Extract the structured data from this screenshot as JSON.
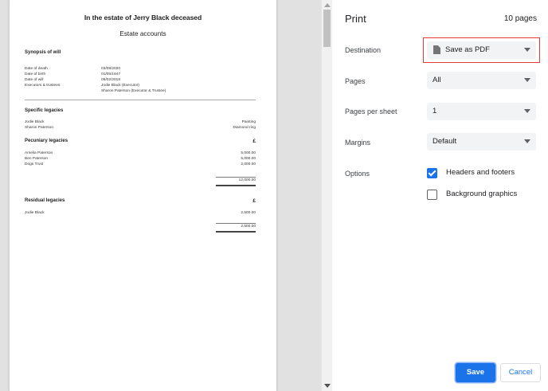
{
  "document": {
    "title": "In the estate of Jerry Black deceased",
    "subtitle": "Estate accounts",
    "synopsis": {
      "heading": "Synopsis of will",
      "rows": [
        {
          "label": "Date of death",
          "value": "03/08/2020"
        },
        {
          "label": "Date of birth",
          "value": "01/05/1947"
        },
        {
          "label": "Date of will",
          "value": "05/02/2018"
        },
        {
          "label": "Executors & trustees",
          "value": "Jodie Black (Executor)"
        },
        {
          "label": "",
          "value": "Sharon Paterson (Executor & Trustee)"
        }
      ]
    },
    "specific_legacies": {
      "heading": "Specific legacies",
      "rows": [
        {
          "label": "Jodie Black",
          "amount": "Painting"
        },
        {
          "label": "Sharon Paterson",
          "amount": "Diamond ring"
        }
      ]
    },
    "pecuniary_legacies": {
      "heading": "Pecuniary legacies",
      "currency": "£",
      "rows": [
        {
          "label": "Amelia Paterson",
          "amount": "5,000.00"
        },
        {
          "label": "Ben Paterson",
          "amount": "5,000.00"
        },
        {
          "label": "Dogs Trust",
          "amount": "2,000.00"
        }
      ],
      "total": "12,000.00"
    },
    "residual_legacies": {
      "heading": "Residual legacies",
      "currency": "£",
      "rows": [
        {
          "label": "Jodie Black",
          "amount": "2,500.00"
        }
      ],
      "total": "2,500.00"
    }
  },
  "panel": {
    "title": "Print",
    "page_count": "10 pages",
    "destination": {
      "label": "Destination",
      "value": "Save as PDF",
      "icon": "document-icon"
    },
    "pages": {
      "label": "Pages",
      "value": "All"
    },
    "pages_per_sheet": {
      "label": "Pages per sheet",
      "value": "1"
    },
    "margins": {
      "label": "Margins",
      "value": "Default"
    },
    "options": {
      "label": "Options",
      "headers_footers": {
        "label": "Headers and footers",
        "checked": true
      },
      "background_graphics": {
        "label": "Background graphics",
        "checked": false
      }
    },
    "save_label": "Save",
    "cancel_label": "Cancel"
  },
  "colors": {
    "accent": "#1a73e8",
    "highlight": "#e53935"
  }
}
